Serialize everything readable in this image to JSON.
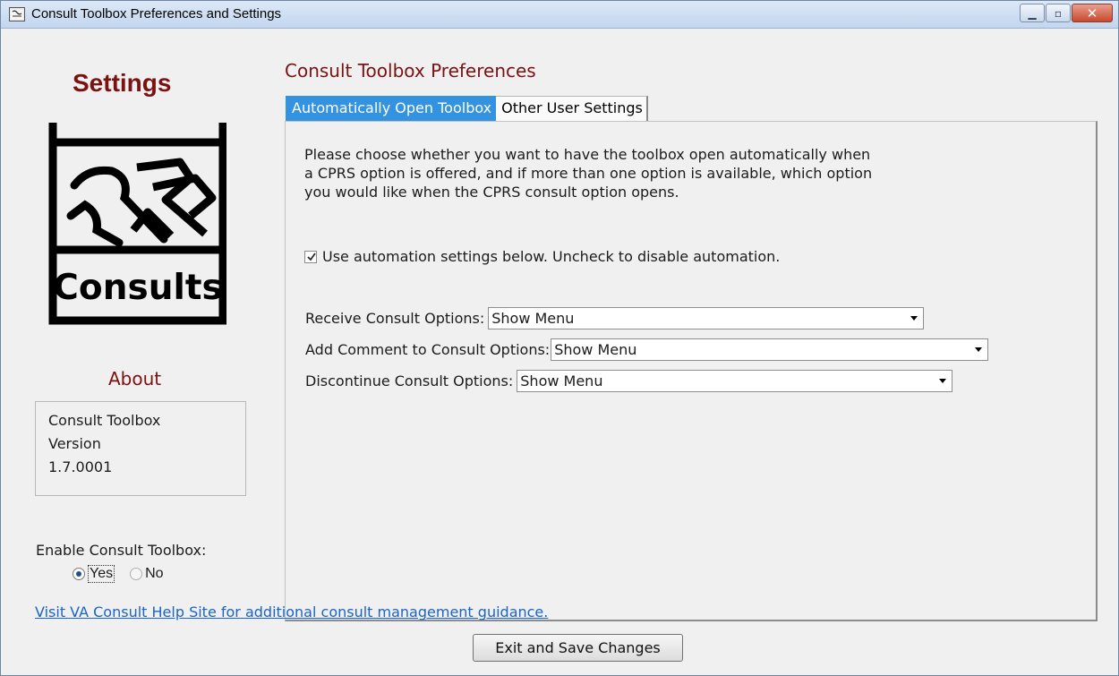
{
  "window": {
    "title": "Consult Toolbox Preferences and Settings",
    "minimize_glyph": "▁",
    "maximize_glyph": "▫",
    "close_glyph": "✕"
  },
  "sidebar": {
    "heading": "Settings",
    "logo_text": "Consults",
    "about_heading": "About",
    "about_lines": [
      "Consult Toolbox",
      "Version",
      "1.7.0001"
    ],
    "enable_label": "Enable Consult Toolbox:",
    "enable_options": [
      {
        "label": "Yes",
        "selected": true
      },
      {
        "label": "No",
        "selected": false
      }
    ]
  },
  "main": {
    "heading": "Consult Toolbox Preferences",
    "tabs": [
      {
        "label": "Automatically Open Toolbox",
        "active": true
      },
      {
        "label": "Other User Settings",
        "active": false
      }
    ],
    "intro_lines": [
      "Please choose whether you want to have the toolbox open automatically when",
      "a CPRS option is offered, and if more than one option is available, which option",
      "you would like when the CPRS consult option opens."
    ],
    "automation_checkbox": {
      "label": "Use automation settings below. Uncheck to disable automation.",
      "checked": true
    },
    "options": [
      {
        "label": "Receive Consult Options:",
        "value": "Show Menu"
      },
      {
        "label": "Add Comment to Consult Options:",
        "value": "Show Menu"
      },
      {
        "label": "Discontinue Consult Options:",
        "value": "Show Menu"
      }
    ]
  },
  "footer": {
    "help_link": "Visit VA Consult Help Site for additional consult management guidance.",
    "exit_button": "Exit and Save Changes"
  },
  "colors": {
    "heading_red": "#7a1212",
    "tab_active_blue": "#3393e0",
    "link_blue": "#1a64c8"
  }
}
